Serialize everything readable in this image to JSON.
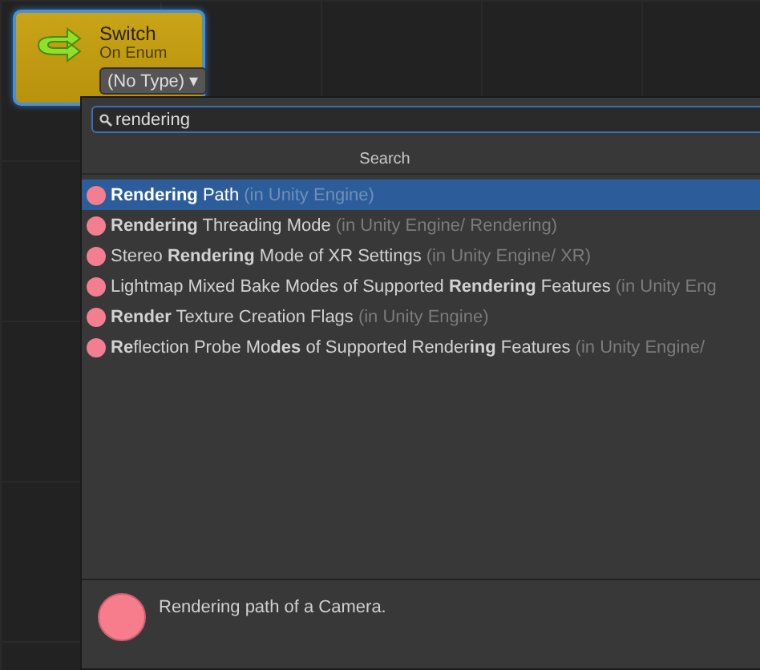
{
  "node": {
    "title": "Switch",
    "subtitle": "On Enum",
    "type_dropdown": "(No Type)",
    "caret": "▾"
  },
  "popup": {
    "search": {
      "value": "rendering"
    },
    "header": "Search",
    "items": [
      {
        "label": "**Rendering** Path",
        "location": "(in Unity Engine)",
        "selected": true
      },
      {
        "label": "**Rendering** Threading Mode",
        "location": "(in Unity Engine/ Rendering)",
        "selected": false
      },
      {
        "label": "Stereo **Rendering** Mode of XR Settings",
        "location": "(in Unity Engine/ XR)",
        "selected": false
      },
      {
        "label": "Lightmap Mixed Bake Modes of Supported **Rendering** Features",
        "location": "(in Unity Eng",
        "selected": false
      },
      {
        "label": "**Render** Texture Creation Flags",
        "location": "(in Unity Engine)",
        "selected": false
      },
      {
        "label": "**Re**flection Probe Mo**des** of Supported Render**ing** Features",
        "location": "(in Unity Engine/",
        "selected": false
      }
    ],
    "description": "Rendering path of a Camera."
  }
}
